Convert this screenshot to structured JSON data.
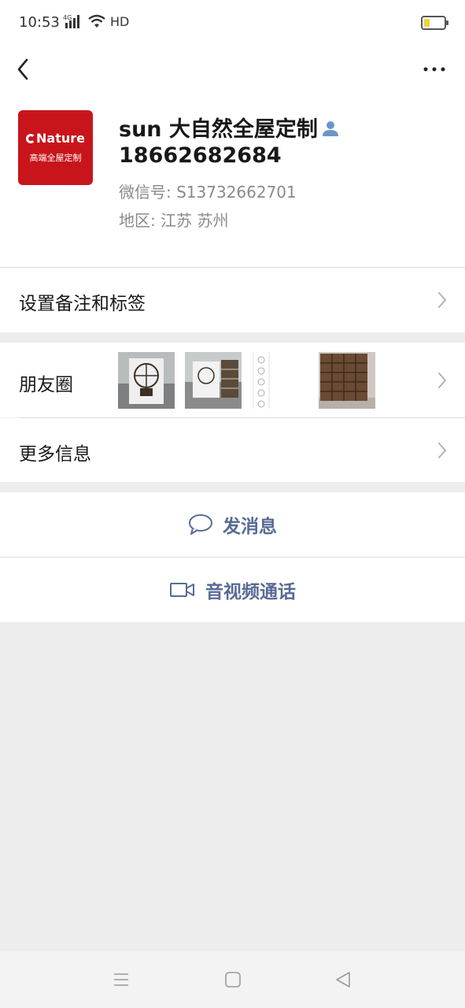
{
  "status_bar": {
    "time": "10:53",
    "network": "4G",
    "hd": "HD",
    "battery_level": 0.3,
    "battery_color": "#f5d23a"
  },
  "nav": {
    "back_icon": "chevron-left-icon",
    "more_icon": "more-dots-icon"
  },
  "profile": {
    "avatar_logo_text": "Nature",
    "avatar_sub_text": "高端全屋定制",
    "avatar_color": "#c8151b",
    "nickname": "sun 大自然全屋定制",
    "phone": "18662682684",
    "wechat_id": "微信号: S13732662701",
    "region": "地区: 江苏  苏州"
  },
  "rows": {
    "remark_label": "设置备注和标签",
    "moments_label": "朋友圈",
    "more_info_label": "更多信息"
  },
  "actions": {
    "message_label": "发消息",
    "call_label": "音视频通话",
    "accent_color": "#576b95"
  }
}
